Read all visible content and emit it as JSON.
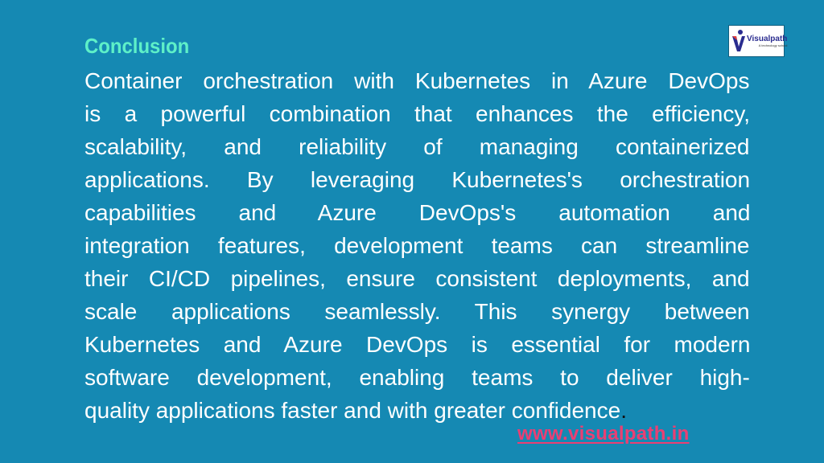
{
  "slide": {
    "heading": "Conclusion",
    "body_lines": [
      "Container orchestration with Kubernetes in Azure DevOps",
      "is a powerful combination that enhances the efficiency,",
      "scalability, and reliability of managing containerized",
      "applications. By leveraging Kubernetes's orchestration",
      "capabilities and Azure DevOps's automation and",
      "integration features, development teams can streamline",
      "their CI/CD pipelines, ensure consistent deployments, and",
      "scale applications seamlessly. This synergy between",
      "Kubernetes and Azure DevOps is essential for modern",
      "software development, enabling teams to deliver high-",
      "quality applications faster and with greater confidence"
    ],
    "final_period": "."
  },
  "logo": {
    "icon": "visualpath-logo-icon",
    "name": "Visualpath",
    "tagline": "A technology school"
  },
  "footer": {
    "website": "www.visualpath.in"
  },
  "colors": {
    "background": "#1589b3",
    "heading": "#5ef0c8",
    "body_text": "#ffffff",
    "website_link": "#ea3f73"
  }
}
